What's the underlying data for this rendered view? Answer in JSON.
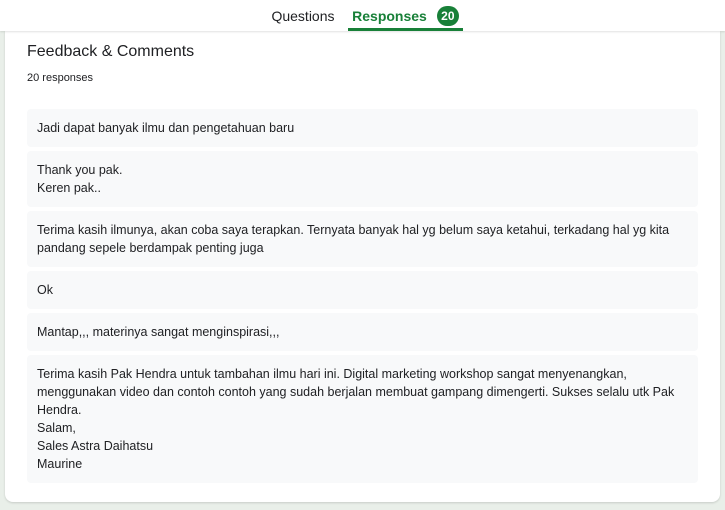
{
  "tabs": {
    "questions_label": "Questions",
    "responses_label": "Responses",
    "responses_count": "20"
  },
  "card": {
    "title": "Feedback & Comments",
    "count_text": "20 responses"
  },
  "responses": [
    "Jadi dapat banyak ilmu dan pengetahuan baru",
    "Thank you pak.\nKeren pak..",
    "Terima kasih ilmunya, akan coba saya terapkan. Ternyata banyak hal yg belum saya ketahui, terkadang hal yg kita pandang sepele berdampak penting juga",
    "Ok",
    "Mantap,,, materinya sangat menginspirasi,,,",
    "Terima kasih Pak Hendra untuk tambahan ilmu hari ini. Digital marketing workshop sangat menyenangkan, menggunakan video dan contoh contoh yang sudah berjalan membuat gampang dimengerti. Sukses selalu utk Pak Hendra.\nSalam,\nSales Astra Daihatsu\nMaurine"
  ],
  "colors": {
    "accent": "#188038",
    "response_bg": "#f8f9fa",
    "page_bg": "#e9efe9"
  }
}
